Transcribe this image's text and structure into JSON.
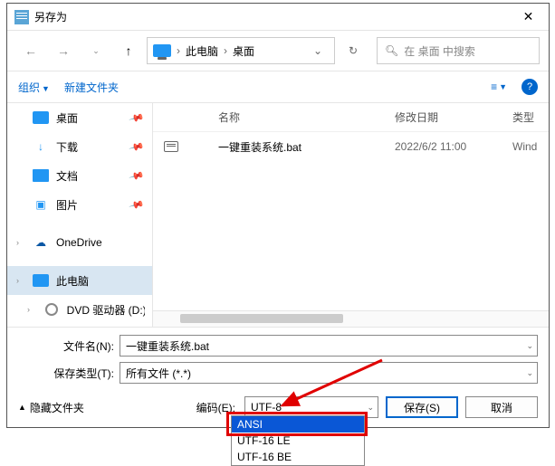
{
  "title": "另存为",
  "path": {
    "seg1": "此电脑",
    "seg2": "桌面"
  },
  "search_placeholder": "在 桌面 中搜索",
  "toolbar": {
    "organize": "组织",
    "newfolder": "新建文件夹"
  },
  "sidebar": {
    "desktop": "桌面",
    "downloads": "下载",
    "documents": "文档",
    "pictures": "图片",
    "onedrive": "OneDrive",
    "thispc": "此电脑",
    "dvd": "DVD 驱动器 (D:)"
  },
  "columns": {
    "name": "名称",
    "date": "修改日期",
    "type": "类型"
  },
  "files": [
    {
      "name": "一键重装系统.bat",
      "date": "2022/6/2 11:00",
      "type": "Wind"
    }
  ],
  "filename_label": "文件名(N):",
  "filename_value": "一键重装系统.bat",
  "savetype_label": "保存类型(T):",
  "savetype_value": "所有文件 (*.*)",
  "hide_folders": "隐藏文件夹",
  "encoding_label": "编码(E):",
  "encoding_value": "UTF-8",
  "save_btn": "保存(S)",
  "cancel_btn": "取消",
  "encoding_options": {
    "o1": "ANSI",
    "o2": "UTF-16 LE",
    "o3": "UTF-16 BE"
  }
}
